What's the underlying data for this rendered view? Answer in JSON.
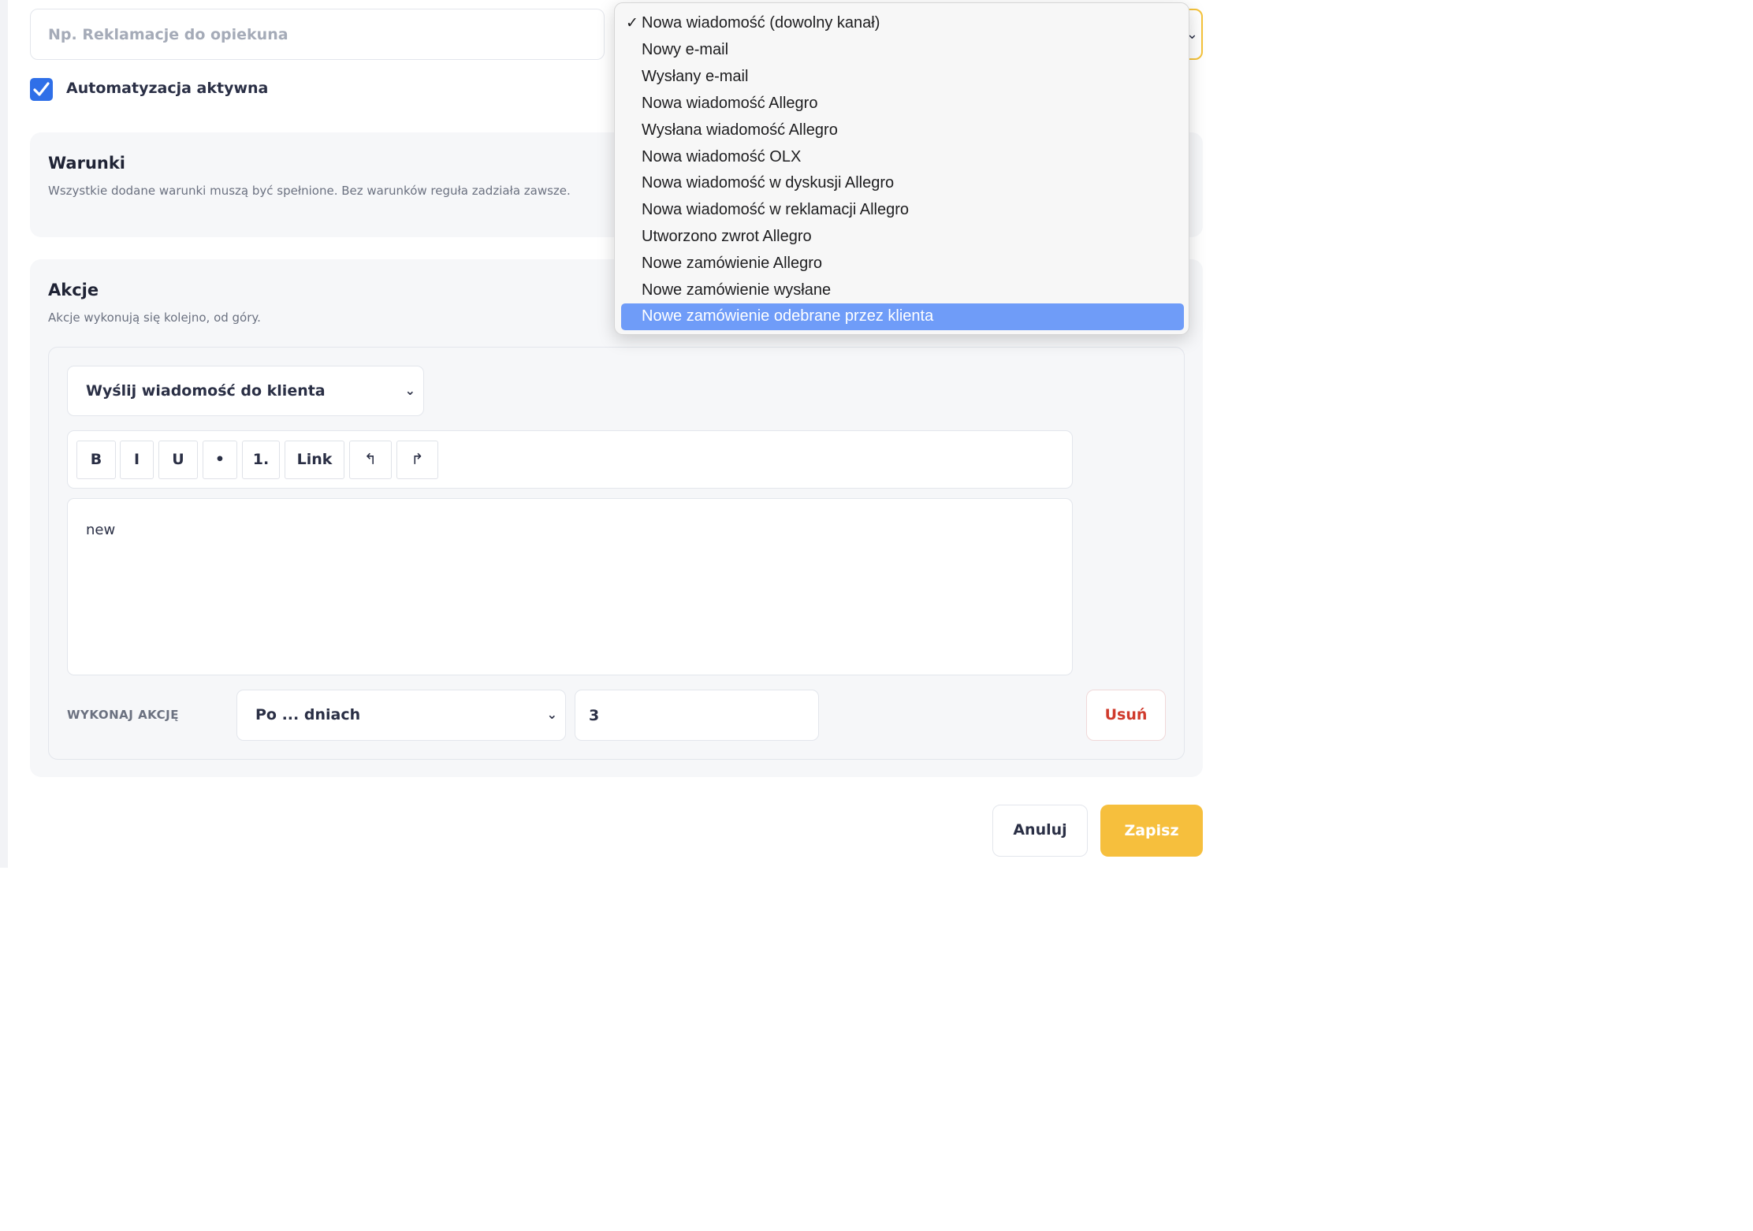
{
  "form": {
    "name_placeholder": "Np. Reklamacje do opiekuna",
    "active_label": "Automatyzacja aktywna"
  },
  "trigger_dropdown": {
    "options": [
      "Nowa wiadomość (dowolny kanał)",
      "Nowy e-mail",
      "Wysłany e-mail",
      "Nowa wiadomość Allegro",
      "Wysłana wiadomość Allegro",
      "Nowa wiadomość OLX",
      "Nowa wiadomość w dyskusji Allegro",
      "Nowa wiadomość w reklamacji Allegro",
      "Utworzono zwrot Allegro",
      "Nowe zamówienie Allegro",
      "Nowe zamówienie wysłane",
      "Nowe zamówienie odebrane przez klienta"
    ],
    "checked": "Nowa wiadomość (dowolny kanał)",
    "highlighted": "Nowe zamówienie odebrane przez klienta"
  },
  "conditions": {
    "title": "Warunki",
    "subtitle": "Wszystkie dodane warunki muszą być spełnione. Bez warunków reguła zadziała zawsze."
  },
  "actions": {
    "title": "Akcje",
    "subtitle": "Akcje wykonują się kolejno, od góry.",
    "action_type": "Wyślij wiadomość do klienta",
    "toolbar": {
      "bold": "B",
      "italic": "I",
      "underline": "U",
      "bullet": "•",
      "numbered": "1.",
      "link": "Link",
      "undo": "↰",
      "redo": "↱"
    },
    "message_body": "new",
    "execute_label": "WYKONAJ AKCJĘ",
    "timing": "Po ... dniach",
    "days": "3",
    "delete_label": "Usuń"
  },
  "footer": {
    "cancel_label": "Anuluj",
    "save_label": "Zapisz"
  },
  "colors": {
    "accent": "#f6bf3d",
    "checkbox": "#2f6fe8",
    "danger": "#d03a2c",
    "menu_highlight": "#6f9cf8"
  },
  "icons": {
    "checkbox": "check-icon",
    "select_arrow": "chevron-down-icon"
  }
}
